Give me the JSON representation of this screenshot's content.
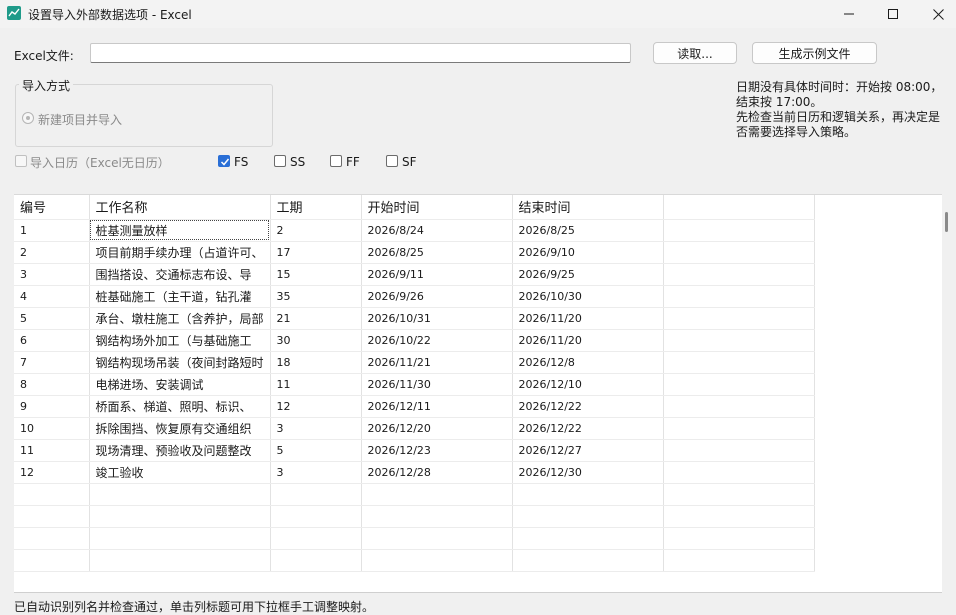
{
  "window": {
    "title": "设置导入外部数据选项 - Excel",
    "minimize_icon": "minimize-icon",
    "maximize_icon": "maximize-icon",
    "close_icon": "close-icon"
  },
  "file": {
    "label": "Excel文件:",
    "value": "",
    "read_button": "读取...",
    "sample_button": "生成示例文件"
  },
  "import_mode": {
    "title": "导入方式",
    "option_label": "新建项目并导入"
  },
  "options": {
    "import_calendar": "导入日历（Excel无日历）",
    "fs": "FS",
    "ss": "SS",
    "ff": "FF",
    "sf": "SF"
  },
  "note": {
    "line1": "日期没有具体时间时：开始按 08:00，结束按 17:00。",
    "line2": "先检查当前日历和逻辑关系，再决定是否需要选择导入策略。"
  },
  "grid": {
    "headers": [
      "编号",
      "工作名称",
      "工期",
      "开始时间",
      "结束时间",
      ""
    ],
    "rows": [
      [
        "1",
        "桩基测量放样",
        "2",
        "2026/8/24",
        "2026/8/25",
        ""
      ],
      [
        "2",
        "项目前期手续办理（占道许可、",
        "17",
        "2026/8/25",
        "2026/9/10",
        ""
      ],
      [
        "3",
        "围挡搭设、交通标志布设、导",
        "15",
        "2026/9/11",
        "2026/9/25",
        ""
      ],
      [
        "4",
        "桩基础施工（主干道，钻孔灌",
        "35",
        "2026/9/26",
        "2026/10/30",
        ""
      ],
      [
        "5",
        "承台、墩柱施工（含养护，局部",
        "21",
        "2026/10/31",
        "2026/11/20",
        ""
      ],
      [
        "6",
        "钢结构场外加工（与基础施工",
        "30",
        "2026/10/22",
        "2026/11/20",
        ""
      ],
      [
        "7",
        "钢结构现场吊装（夜间封路短时",
        "18",
        "2026/11/21",
        "2026/12/8",
        ""
      ],
      [
        "8",
        "电梯进场、安装调试",
        "11",
        "2026/11/30",
        "2026/12/10",
        ""
      ],
      [
        "9",
        "桥面系、梯道、照明、标识、",
        "12",
        "2026/12/11",
        "2026/12/22",
        ""
      ],
      [
        "10",
        "拆除围挡、恢复原有交通组织",
        "3",
        "2026/12/20",
        "2026/12/22",
        ""
      ],
      [
        "11",
        "现场清理、预验收及问题整改",
        "5",
        "2026/12/23",
        "2026/12/27",
        ""
      ],
      [
        "12",
        "竣工验收",
        "3",
        "2026/12/28",
        "2026/12/30",
        ""
      ]
    ]
  },
  "footer": {
    "text": "已自动识别列名并检查通过，单击列标题可用下拉框手工调整映射。"
  },
  "colors": {
    "accent": "#2a6fd6",
    "window_bg": "#f0f0f0",
    "app_icon": "#1f9b8a"
  }
}
